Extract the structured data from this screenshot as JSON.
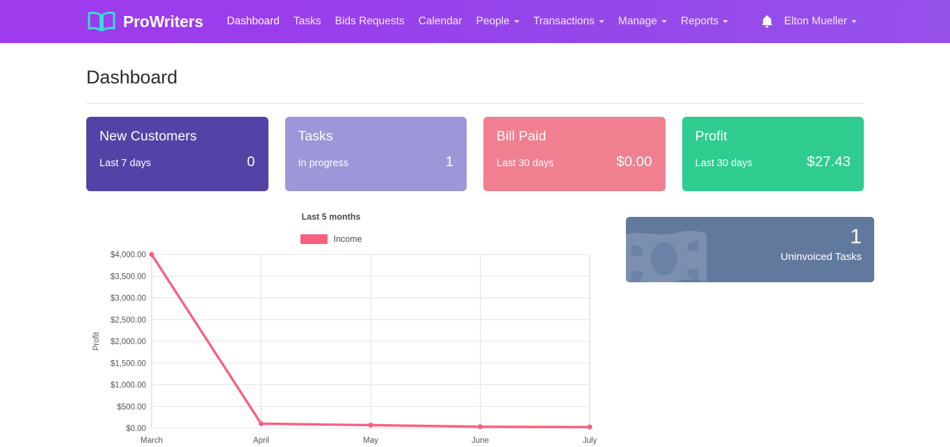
{
  "navbar": {
    "brand": "ProWriters",
    "brand_icon": "open-book-icon",
    "links": [
      {
        "label": "Dashboard",
        "caret": false
      },
      {
        "label": "Tasks",
        "caret": false
      },
      {
        "label": "Bids Requests",
        "caret": false
      },
      {
        "label": "Calendar",
        "caret": false
      },
      {
        "label": "People",
        "caret": true
      },
      {
        "label": "Transactions",
        "caret": true
      },
      {
        "label": "Manage",
        "caret": true
      },
      {
        "label": "Reports",
        "caret": true
      }
    ],
    "notification_icon": "bell-icon",
    "user": "Elton Mueller",
    "gradient_start": "#a03ced",
    "gradient_end": "#9650ea"
  },
  "page": {
    "title": "Dashboard"
  },
  "cards": [
    {
      "title": "New Customers",
      "subtitle": "Last 7 days",
      "value": "0",
      "color": "#5442a6"
    },
    {
      "title": "Tasks",
      "subtitle": "In progress",
      "value": "1",
      "color": "#9b97d8"
    },
    {
      "title": "Bill Paid",
      "subtitle": "Last 30 days",
      "value": "$0.00",
      "color": "#f07f8f"
    },
    {
      "title": "Profit",
      "subtitle": "Last 30 days",
      "value": "$27.43",
      "color": "#2ecc8f"
    }
  ],
  "invoice_card": {
    "count": "1",
    "label": "Uninvoiced Tasks",
    "icon": "banknote-icon",
    "color": "#62799e"
  },
  "chart_data": {
    "type": "line",
    "title": "Last 5 months",
    "xlabel": "",
    "ylabel": "Profit",
    "categories": [
      "March",
      "April",
      "May",
      "June",
      "July"
    ],
    "series": [
      {
        "name": "Income",
        "color": "#f9607f",
        "values": [
          4000.0,
          105.0,
          72.0,
          35.0,
          27.43
        ]
      }
    ],
    "ytick_labels": [
      "$4,000.00",
      "$3,500.00",
      "$3,000.00",
      "$2,500.00",
      "$2,000.00",
      "$1,500.00",
      "$1,000.00",
      "$500.00",
      "$0.00"
    ],
    "ytick_values": [
      4000,
      3500,
      3000,
      2500,
      2000,
      1500,
      1000,
      500,
      0
    ],
    "ylim": [
      0,
      4000
    ],
    "grid": true,
    "legend_position": "top"
  }
}
